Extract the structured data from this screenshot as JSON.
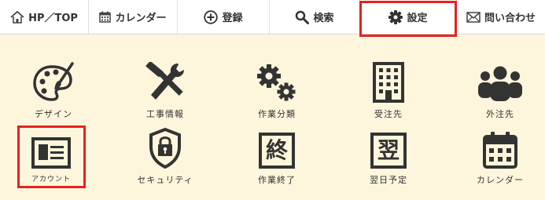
{
  "nav": {
    "home": "HP／TOP",
    "calendar": "カレンダー",
    "register": "登録",
    "search": "検索",
    "settings": "設定",
    "contact": "問い合わせ"
  },
  "tiles": {
    "design": "デザイン",
    "work_info": "工事情報",
    "work_category": "作業分類",
    "client": "受注先",
    "subcontractor": "外注先",
    "account": "アカウント",
    "security": "セキュリティ",
    "work_end": "作業終了",
    "schedule": "翌日予定",
    "calendar": "カレンダー",
    "work_end_glyph": "終",
    "schedule_glyph": "翌"
  },
  "colors": {
    "background": "#fdf6dc",
    "icon": "#333333",
    "highlight": "#e8211d"
  },
  "highlighted": [
    "settings",
    "account"
  ]
}
